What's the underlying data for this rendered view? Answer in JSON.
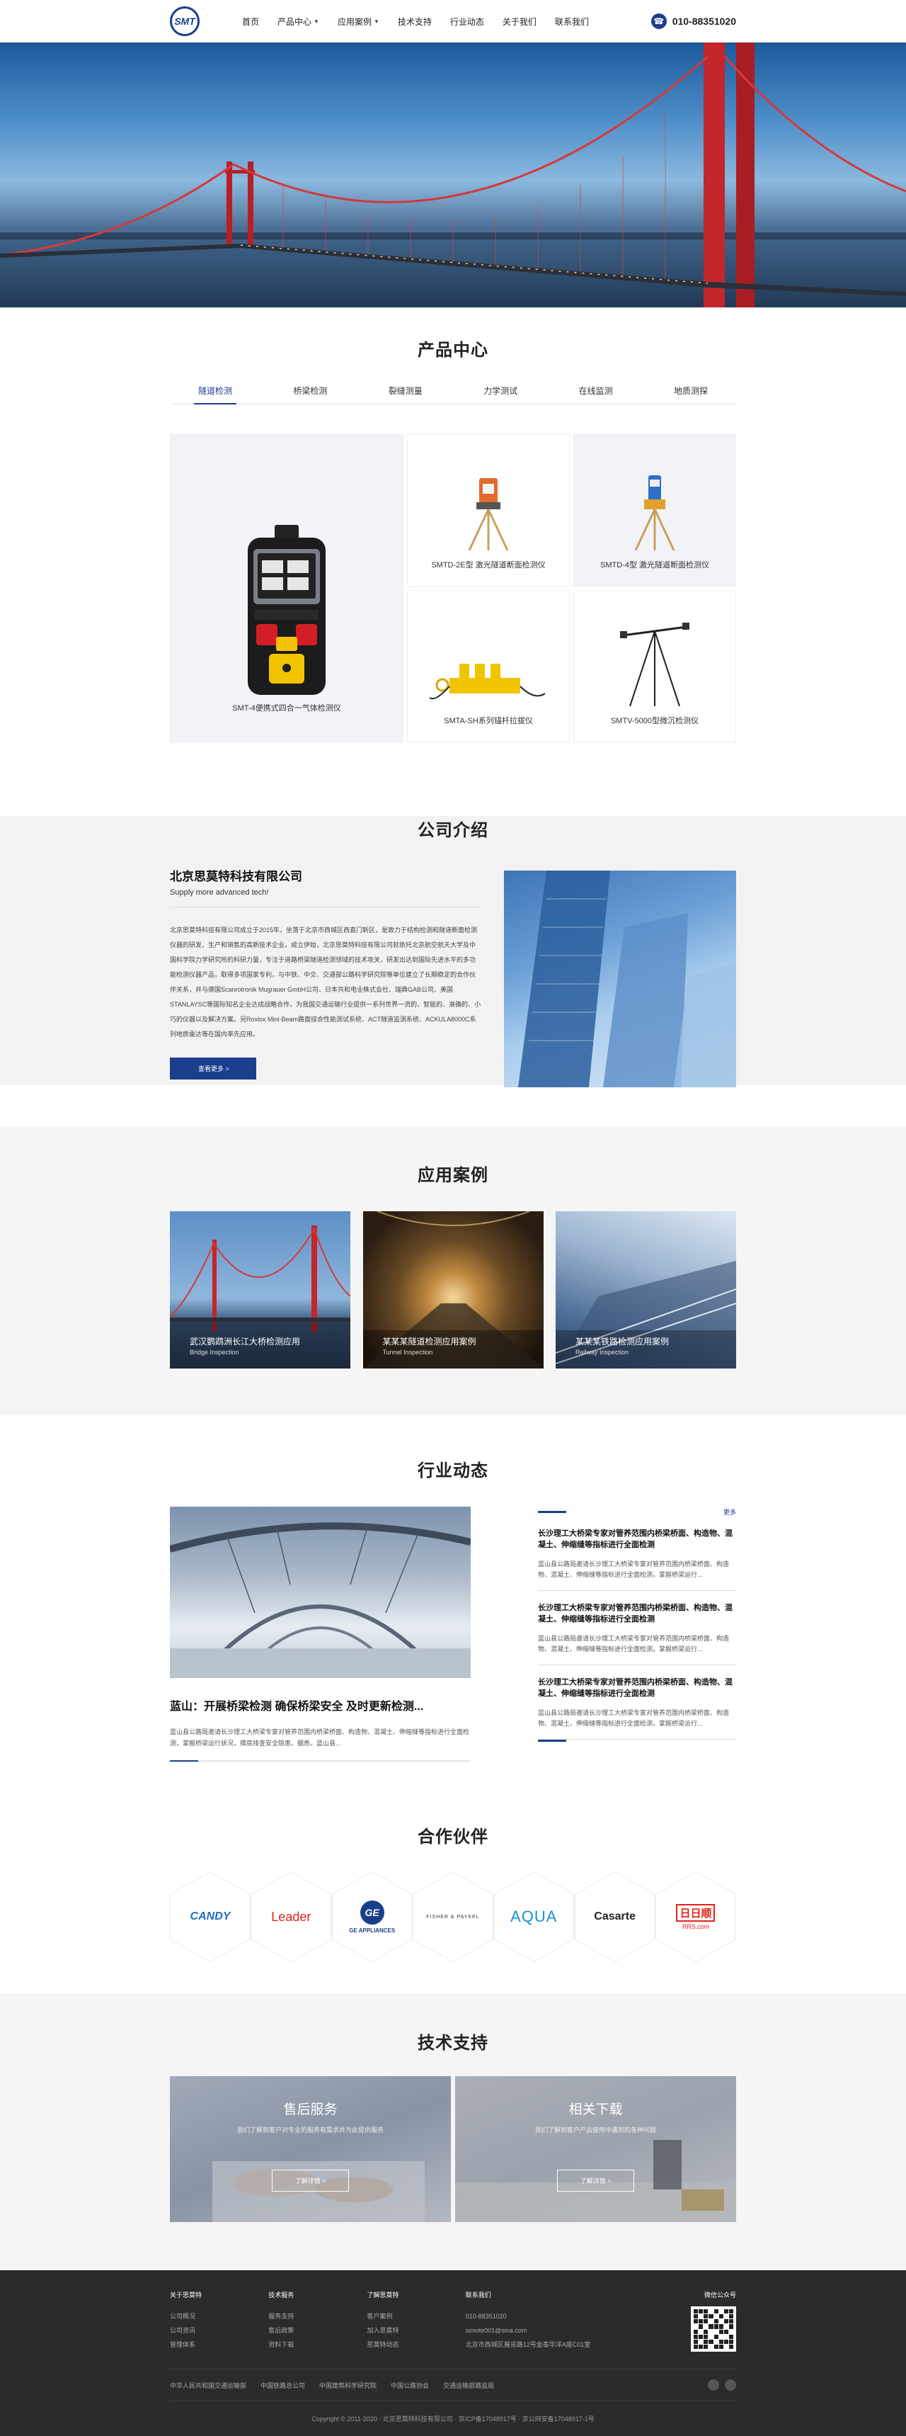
{
  "header": {
    "logo_text": "SMT",
    "nav": [
      {
        "label": "首页",
        "dropdown": false
      },
      {
        "label": "产品中心",
        "dropdown": true
      },
      {
        "label": "应用案例",
        "dropdown": true
      },
      {
        "label": "技术支持",
        "dropdown": false
      },
      {
        "label": "行业动态",
        "dropdown": false
      },
      {
        "label": "关于我们",
        "dropdown": false
      },
      {
        "label": "联系我们",
        "dropdown": false
      }
    ],
    "phone": "010-88351020"
  },
  "products": {
    "title": "产品中心",
    "tabs": [
      "隧道检测",
      "桥梁检测",
      "裂缝测量",
      "力学测试",
      "在线监测",
      "地质测探"
    ],
    "active_tab": 0,
    "items": [
      {
        "name": "SMT-4便携式四合一气体检测仪"
      },
      {
        "name": "SMTD-2E型 激光隧道断面检测仪"
      },
      {
        "name": "SMTD-4型 激光隧道断面检测仪"
      },
      {
        "name": "SMTA-SH系列锚杆拉拔仪"
      },
      {
        "name": "SMTV-5000型微沉检测仪"
      }
    ]
  },
  "about": {
    "title": "公司介绍",
    "company": "北京思莫特科技有限公司",
    "slogan": "Supply more advanced tech!",
    "body": "北京思莫特科技有限公司成立于2015年，坐落于北京市西城区西直门新区，是致力于结构检测和隧道断面检测仪器的研发、生产和销售的高新技术企业。成立伊始，北京思莫特科技有限公司就依托北京航空航天大学及中国科学院力学研究所的科研力量，专注于道路桥梁隧道检测领域的技术攻关，研发出达到国际先进水平的多功能检测仪器产品，取得多项国家专利，与中铁、中交、交通部公路科学研究院等单位建立了长期稳定的合作伙伴关系，并与德国Scanrotronik Mugrauer GmbH公司、日本共和电业株式会社、瑞典GAB公司、美国STANLAYSC等国际知名企业达成战略合作，为我国交通运输行业提供一系列世界一流的、智能的、准确的、小巧的仪器以及解决方案。另Roxlox Mini-Beam路面综合性能测试系统、ACT隧道监测系统、ACKULA8000C系列地质雷达等在国内率先应用。",
    "more": "查看更多 >"
  },
  "cases": {
    "title": "应用案例",
    "items": [
      {
        "title": "武汉鹦鹉洲长江大桥检测应用",
        "sub": "Bridge Inspection"
      },
      {
        "title": "某某某隧道检测应用案例",
        "sub": "Tunnel Inspection"
      },
      {
        "title": "某某某铁路检测应用案例",
        "sub": "Railway Inspection"
      }
    ]
  },
  "news": {
    "title": "行业动态",
    "main_title": "蓝山：开展桥梁检测 确保桥梁安全 及时更新检测...",
    "main_desc": "蓝山县公路局邀请长沙理工大桥梁专家对管养范围内桥梁桥面、构造物、混凝土、伸缩缝等指标进行全面检测，掌握桥梁运行状况，摸底排查安全隐患。据悉，蓝山县...",
    "more": "更多",
    "side": [
      {
        "title": "长沙理工大桥梁专家对管养范围内桥梁桥面、构造物、混凝土、伸缩缝等指标进行全面检测",
        "desc": "蓝山县公路局邀请长沙理工大桥梁专家对管养范围内桥梁桥面、构造物、混凝土、伸缩缝等指标进行全面检测，掌握桥梁运行..."
      },
      {
        "title": "长沙理工大桥梁专家对管养范围内桥梁桥面、构造物、混凝土、伸缩缝等指标进行全面检测",
        "desc": "蓝山县公路局邀请长沙理工大桥梁专家对管养范围内桥梁桥面、构造物、混凝土、伸缩缝等指标进行全面检测，掌握桥梁运行..."
      },
      {
        "title": "长沙理工大桥梁专家对管养范围内桥梁桥面、构造物、混凝土、伸缩缝等指标进行全面检测",
        "desc": "蓝山县公路局邀请长沙理工大桥梁专家对管养范围内桥梁桥面、构造物、混凝土、伸缩缝等指标进行全面检测，掌握桥梁运行..."
      }
    ]
  },
  "partners": {
    "title": "合作伙伴",
    "items": [
      {
        "name": "CANDY",
        "color": "#1a6fc4"
      },
      {
        "name": "Leader",
        "color": "#e2231a"
      },
      {
        "name": "GE APPLIANCES",
        "color": "#1a3e8e"
      },
      {
        "name": "FISHER & PAYKEL",
        "color": "#333333"
      },
      {
        "name": "AQUA",
        "color": "#1a8fd4"
      },
      {
        "name": "Casarte",
        "color": "#222222"
      },
      {
        "name": "日日顺",
        "sub": "RRS.com",
        "color": "#e2231a"
      }
    ]
  },
  "support": {
    "title": "技术支持",
    "items": [
      {
        "title": "售后服务",
        "desc": "我们了解到客户对专业的服务有需求并为此提供服务",
        "btn": "了解详情 >"
      },
      {
        "title": "相关下载",
        "desc": "我们了解到客户产品使用中遇到的各种问题",
        "btn": "了解详情 >"
      }
    ]
  },
  "footer": {
    "cols": [
      {
        "title": "关于思莫特",
        "links": [
          "公司概况",
          "公司资讯",
          "管理体系"
        ]
      },
      {
        "title": "技术服务",
        "links": [
          "服务支持",
          "售后政策",
          "资料下载"
        ]
      },
      {
        "title": "了解思莫特",
        "links": [
          "客户案例",
          "加入思莫特",
          "思莫特动态"
        ]
      }
    ],
    "contact_title": "联系我们",
    "contact": [
      "010-88351020",
      "simote001@sina.com",
      "北京市西城区展览路12号金泰华洋A座C01室"
    ],
    "qr_title": "微信公众号",
    "links": [
      "中华人民共和国交通运输部",
      "中国铁路总公司",
      "中国建筑科学研究院",
      "中国公路协会",
      "交通运输部路监局"
    ],
    "copyright": "Copyright © 2011-2020 · 北京思莫特科技有限公司 · 京ICP备17048917号 · 京公网安备17048917-1号"
  },
  "colors": {
    "brand": "#1b3e8e"
  }
}
